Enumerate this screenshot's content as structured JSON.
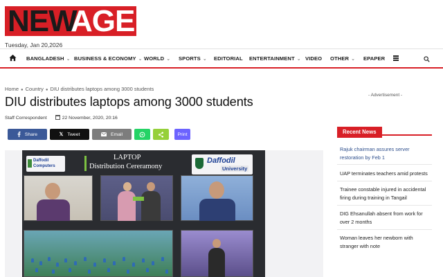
{
  "brand": {
    "logo_part1": "NEW",
    "logo_part2": "AGE",
    "color": "#d81f26"
  },
  "header": {
    "date": "Tuesday, Jan 20,2026"
  },
  "nav": {
    "home_icon": "home-icon",
    "items": [
      {
        "label": "BANGLADESH",
        "dropdown": true
      },
      {
        "label": "BUSINESS & ECONOMY",
        "dropdown": true
      },
      {
        "label": "WORLD",
        "dropdown": true
      },
      {
        "label": "SPORTS",
        "dropdown": true
      },
      {
        "label": "EDITORIAL",
        "dropdown": false
      },
      {
        "label": "ENTERTAINMENT",
        "dropdown": true
      },
      {
        "label": "VIDEO",
        "dropdown": false
      },
      {
        "label": "OTHER",
        "dropdown": true
      },
      {
        "label": "EPAPER",
        "dropdown": false
      }
    ],
    "menu_icon": "hamburger-menu-icon",
    "search_icon": "search-icon"
  },
  "breadcrumb": {
    "home": "Home",
    "section": "Country",
    "current": "DIU distributes laptops among 3000 students"
  },
  "article": {
    "title": "DIU distributes laptops among 3000 students",
    "author": "Staff Correspondent",
    "date": "22 November, 2020, 20:16"
  },
  "share": {
    "facebook": {
      "label": "Share",
      "color": "#3b5998",
      "icon": "facebook-icon"
    },
    "twitter": {
      "label": "Tweet",
      "color": "#111111",
      "icon": "x-icon"
    },
    "email": {
      "label": "Email",
      "color": "#7d7d7d",
      "icon": "email-icon"
    },
    "whatsapp": {
      "color": "#25d366",
      "icon": "whatsapp-icon"
    },
    "sharethis": {
      "color": "#95d03a",
      "icon": "share-icon"
    },
    "print": {
      "label": "Print",
      "color": "#6c63ff"
    }
  },
  "image": {
    "badge_left_line1": "Daffodil",
    "badge_left_line2": "Computers",
    "title_line1": "LAPTOP",
    "title_line2": "Distribution Cereramony",
    "badge_right_line1": "Daffodil",
    "badge_right_line2": "University"
  },
  "sidebar": {
    "advertisement": "- Advertisement -",
    "recent_news_heading": "Recent News",
    "recent_news": [
      "Rajuk chairman assures server restoration by Feb 1",
      "UAP terminates teachers amid protests",
      "Trainee constable injured in accidental firing during training in Tangail",
      "DIG Ehsanullah absent from work for over 2 months",
      "Woman leaves her newborn with stranger with note"
    ]
  }
}
